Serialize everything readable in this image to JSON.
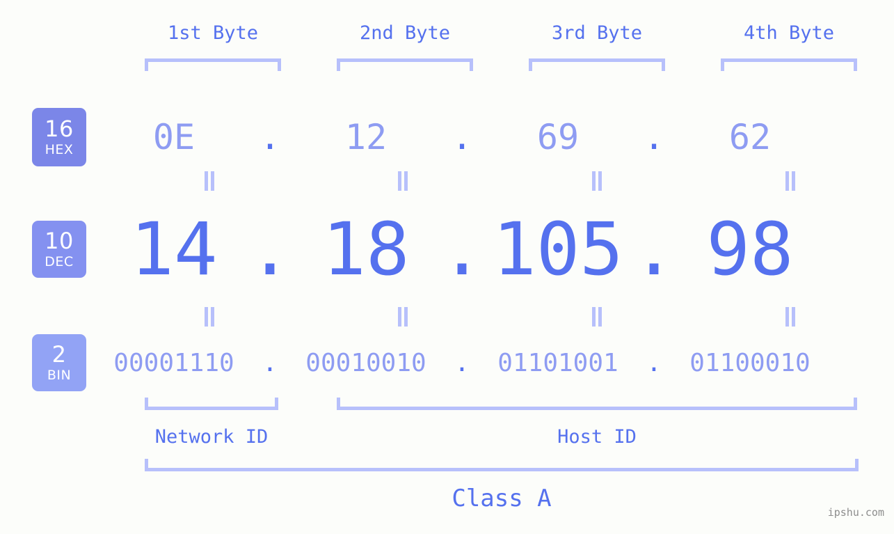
{
  "background_color": "#fcfdfa",
  "accent_color": "#5571ee",
  "muted_accent_color": "#8e9cf2",
  "bracket_color": "#b7c0fb",
  "watermark": "ipshu.com",
  "byte_headers": [
    {
      "label": "1st Byte"
    },
    {
      "label": "2nd Byte"
    },
    {
      "label": "3rd Byte"
    },
    {
      "label": "4th Byte"
    }
  ],
  "bases": [
    {
      "number": "16",
      "name": "HEX",
      "color": "#7b86e8"
    },
    {
      "number": "10",
      "name": "DEC",
      "color": "#8491f0"
    },
    {
      "number": "2",
      "name": "BIN",
      "color": "#92a3f5"
    }
  ],
  "separator": ".",
  "equality_mark": "||",
  "rows": {
    "hex": {
      "values": [
        "0E",
        "12",
        "69",
        "62"
      ]
    },
    "dec": {
      "values": [
        "14",
        "18",
        "105",
        "98"
      ]
    },
    "bin": {
      "values": [
        "00001110",
        "00010010",
        "01101001",
        "01100010"
      ]
    }
  },
  "sections": [
    {
      "label": "Network ID"
    },
    {
      "label": "Host ID"
    }
  ],
  "class": {
    "label": "Class A"
  }
}
